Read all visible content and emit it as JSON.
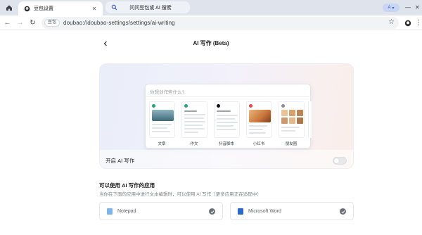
{
  "tabs": [
    {
      "title": "豆包设置",
      "active": true
    },
    {
      "title": "问问豆包或 AI 搜索",
      "active": false
    }
  ],
  "profile_letter": "A",
  "address": {
    "site_chip": "豆包",
    "url": "doubao://doubao-settings/settings/ai-writing"
  },
  "page": {
    "title": "AI 写作 (Beta)"
  },
  "hero": {
    "search_placeholder": "你想创作些什么?",
    "cards": [
      {
        "label": "文章",
        "accent": "#2f9e77",
        "image": "#3d6a7a"
      },
      {
        "label": "作文",
        "accent": "#2f9e77",
        "image": ""
      },
      {
        "label": "抖音脚本",
        "accent": "#111111",
        "image": ""
      },
      {
        "label": "小红书",
        "accent": "#e5484d",
        "image": "#c9723a"
      },
      {
        "label": "朋友圈",
        "accent": "#8d8d8d",
        "image": "#d9a06b"
      }
    ],
    "toggle_label": "开启 AI 写作",
    "toggle_on": false
  },
  "apps_section": {
    "title": "可以使用 AI 写作的应用",
    "description": "当你在下面的应用中进行文本编辑时，可以使用 AI 写作（更多应用正在适配中）",
    "apps": [
      {
        "name": "Notepad",
        "icon_color": "#7fb4e6",
        "checked": true
      },
      {
        "name": "Microsoft Word",
        "icon_color": "#2b6bc4",
        "checked": true
      }
    ]
  },
  "icons": {
    "home": "home-icon",
    "back": "arrow-left-icon",
    "forward": "arrow-right-icon",
    "reload": "reload-icon",
    "star": "star-icon",
    "extension": "doubao-extension-icon",
    "menu": "more-vertical-icon"
  }
}
